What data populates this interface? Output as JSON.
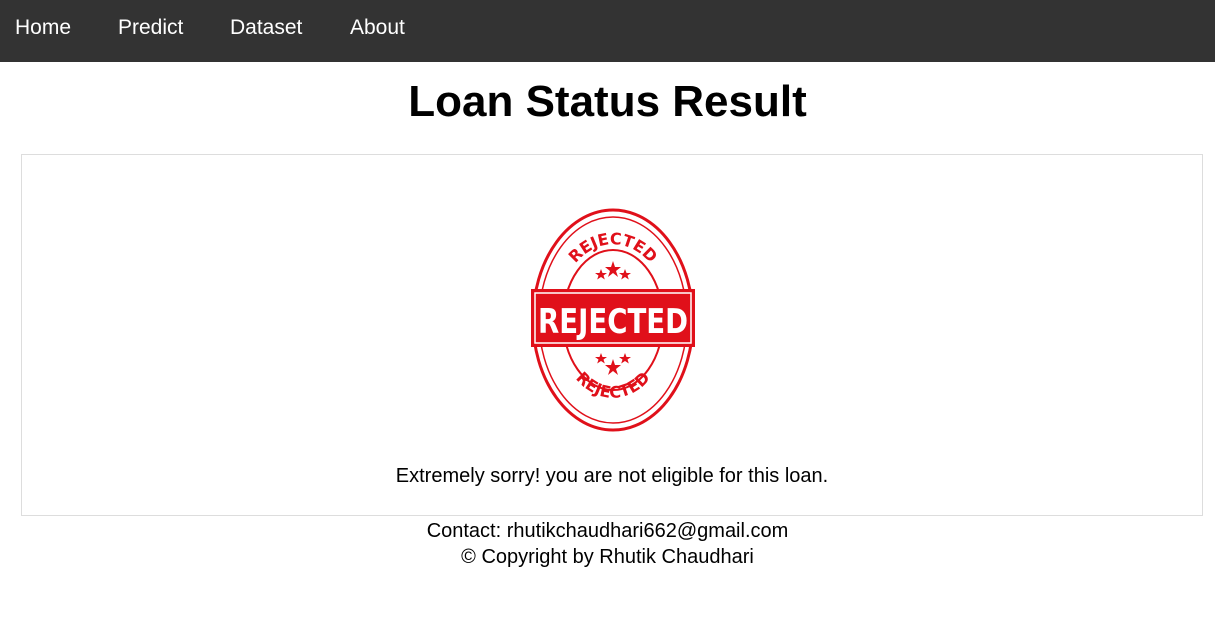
{
  "nav": {
    "home": "Home",
    "predict": "Predict",
    "dataset": "Dataset",
    "about": "About"
  },
  "page": {
    "title": "Loan Status Result"
  },
  "result": {
    "stamp_icon": "rejected-stamp-icon",
    "stamp_text_main": "REJECTED",
    "stamp_text_top": "REJECTED",
    "stamp_text_bottom": "REJECTED",
    "message": "Extremely sorry! you are not eligible for this loan."
  },
  "footer": {
    "contact_label": "Contact:",
    "contact_email": "rhutikchaudhari662@gmail.com",
    "copyright": "© Copyright by Rhutik Chaudhari"
  },
  "colors": {
    "navbar_bg": "#333333",
    "nav_text": "#ffffff",
    "stamp_red": "#e0101a"
  }
}
